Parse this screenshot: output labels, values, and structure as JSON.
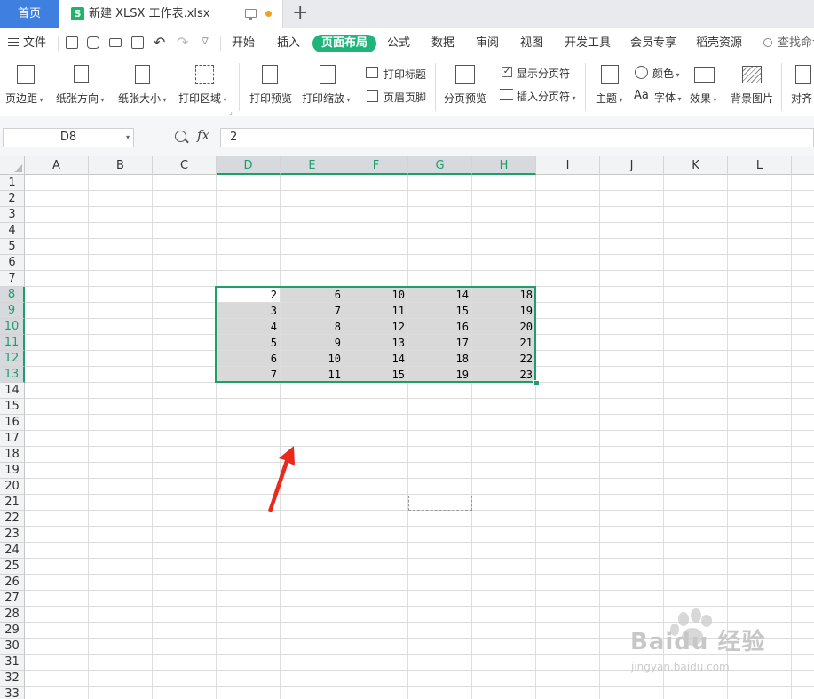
{
  "tabs": {
    "home_label": "首页",
    "file_label": "新建 XLSX 工作表.xlsx",
    "add_label": "+"
  },
  "menu": {
    "file": "文件",
    "items": [
      "开始",
      "插入",
      "页面布局",
      "公式",
      "数据",
      "审阅",
      "视图",
      "开发工具",
      "会员专享",
      "稻壳资源"
    ],
    "active": "页面布局",
    "search_placeholder": "查找命令"
  },
  "ribbon": {
    "margins": "页边距",
    "orientation": "纸张方向",
    "size": "纸张大小",
    "print_area": "打印区域",
    "print_preview": "打印预览",
    "print_scale": "打印缩放",
    "print_titles": "打印标题",
    "header_footer": "页眉页脚",
    "page_break_preview": "分页预览",
    "show_page_breaks": "显示分页符",
    "insert_page_break": "插入分页符",
    "theme": "主题",
    "colors": "颜色",
    "fonts": "字体",
    "fonts_prefix": "Aa",
    "effects": "效果",
    "background": "背景图片",
    "align": "对齐"
  },
  "formula_bar": {
    "name_box": "D8",
    "fx_label": "fx",
    "value": "2"
  },
  "sheet": {
    "columns": [
      "A",
      "B",
      "C",
      "D",
      "E",
      "F",
      "G",
      "H",
      "I",
      "J",
      "K",
      "L"
    ],
    "selected_columns": [
      "D",
      "E",
      "F",
      "G",
      "H"
    ],
    "rows": [
      "1",
      "2",
      "3",
      "4",
      "5",
      "6",
      "7",
      "8",
      "9",
      "10",
      "11",
      "12",
      "13",
      "14",
      "15",
      "16",
      "17",
      "18",
      "19",
      "20",
      "21",
      "22",
      "23",
      "24",
      "25",
      "26",
      "27",
      "28",
      "29",
      "30",
      "31",
      "32",
      "33"
    ],
    "selected_rows": [
      "8",
      "9",
      "10",
      "11",
      "12",
      "13"
    ],
    "data_rows": [
      [
        "2",
        "6",
        "10",
        "14",
        "18"
      ],
      [
        "3",
        "7",
        "11",
        "15",
        "19"
      ],
      [
        "4",
        "8",
        "12",
        "16",
        "20"
      ],
      [
        "5",
        "9",
        "13",
        "17",
        "21"
      ],
      [
        "6",
        "10",
        "14",
        "18",
        "22"
      ],
      [
        "7",
        "11",
        "15",
        "19",
        "23"
      ]
    ],
    "accent_color": "#1f9e6b",
    "arrow_color": "#e8291c"
  },
  "watermark": {
    "brand": "Baidu 经验",
    "url": "jingyan.baidu.com"
  }
}
